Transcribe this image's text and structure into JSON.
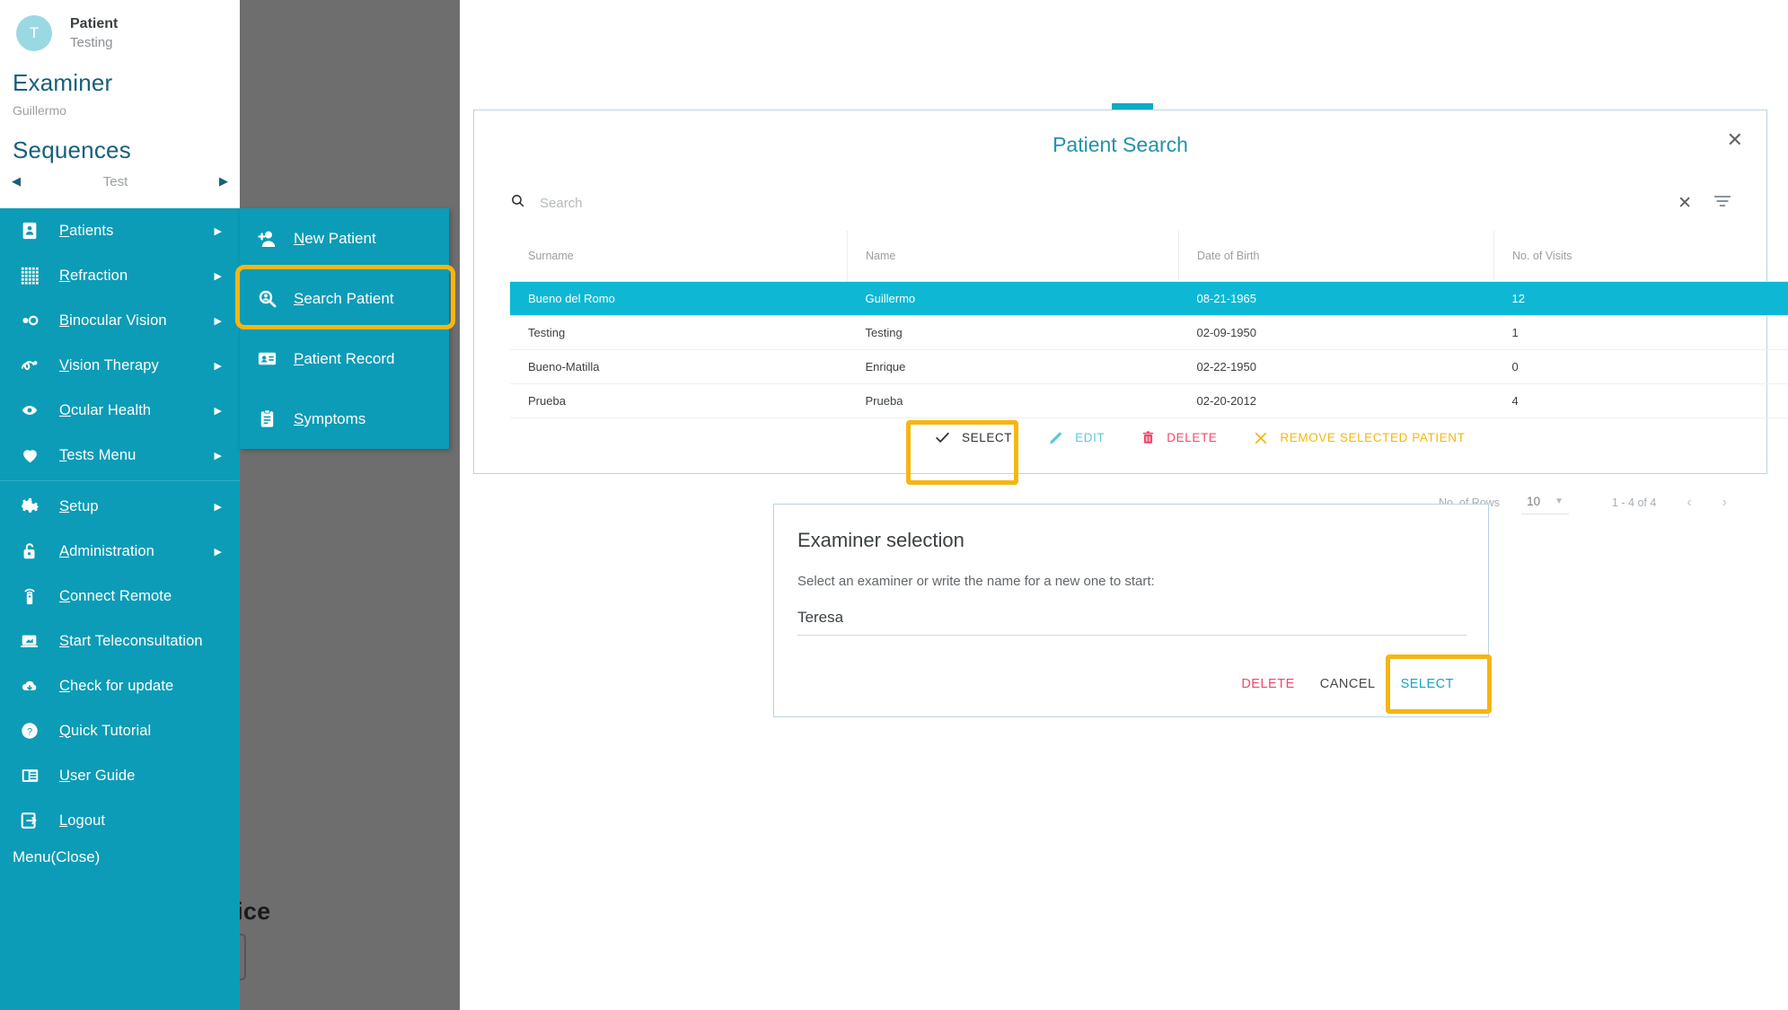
{
  "sidebar": {
    "patient": {
      "avatar_initial": "T",
      "label": "Patient",
      "name": "Testing"
    },
    "examiner": {
      "heading": "Examiner",
      "name": "Guillermo"
    },
    "sequences": {
      "heading": "Sequences",
      "current": "Test",
      "prev_icon": "chevron-left-icon",
      "next_icon": "chevron-right-icon"
    },
    "menu_items": [
      {
        "label": "Patients",
        "icon": "patient-card-icon",
        "caret": true,
        "accel": "P"
      },
      {
        "label": "Refraction",
        "icon": "grid-icon",
        "caret": true,
        "accel": "R"
      },
      {
        "label": "Binocular Vision",
        "icon": "binocular-icon",
        "caret": true,
        "accel": "B"
      },
      {
        "label": "Vision Therapy",
        "icon": "therapy-icon",
        "caret": true,
        "accel": "V"
      },
      {
        "label": "Ocular Health",
        "icon": "eye-icon",
        "caret": true,
        "accel": "O"
      },
      {
        "label": "Tests Menu",
        "icon": "heart-icon",
        "caret": true,
        "accel": "T"
      },
      {
        "label": "Setup",
        "icon": "gear-icon",
        "caret": true,
        "accel": "S"
      },
      {
        "label": "Administration",
        "icon": "lock-open-icon",
        "caret": true,
        "accel": "A"
      },
      {
        "label": "Connect Remote",
        "icon": "remote-icon",
        "caret": false,
        "accel": "C"
      },
      {
        "label": "Start Teleconsultation",
        "icon": "teleconsultation-icon",
        "caret": false,
        "accel": "S"
      },
      {
        "label": "Check for update",
        "icon": "cloud-download-icon",
        "caret": false,
        "accel": "C"
      },
      {
        "label": "Quick Tutorial",
        "icon": "question-circle-icon",
        "caret": false,
        "accel": "Q"
      },
      {
        "label": "User Guide",
        "icon": "book-icon",
        "caret": false,
        "accel": "U"
      },
      {
        "label": "Logout",
        "icon": "logout-icon",
        "caret": false,
        "accel": "L"
      }
    ],
    "menu_close": "Menu(Close)"
  },
  "submenu": {
    "items": [
      {
        "label": "New Patient",
        "icon": "person-add-icon",
        "accel": "N",
        "highlighted": false
      },
      {
        "label": "Search Patient",
        "icon": "search-person-icon",
        "accel": "S",
        "highlighted": true
      },
      {
        "label": "Patient Record",
        "icon": "id-card-icon",
        "accel": "P",
        "highlighted": false
      },
      {
        "label": "Symptoms",
        "icon": "clipboard-icon",
        "accel": "S",
        "highlighted": false
      }
    ]
  },
  "patient_search": {
    "title": "Patient Search",
    "close_icon": "close-icon",
    "search": {
      "placeholder": "Search",
      "value": "",
      "icon": "search-icon",
      "clear_icon": "clear-icon",
      "filter_icon": "filter-icon"
    },
    "columns": [
      "Surname",
      "Name",
      "Date of Birth",
      "No. of Visits"
    ],
    "rows": [
      {
        "surname": "Bueno del Romo",
        "name": "Guillermo",
        "dob": "08-21-1965",
        "visits": "12",
        "selected": true
      },
      {
        "surname": "Testing",
        "name": "Testing",
        "dob": "02-09-1950",
        "visits": "1",
        "selected": false
      },
      {
        "surname": "Bueno-Matilla",
        "name": "Enrique",
        "dob": "02-22-1950",
        "visits": "0",
        "selected": false
      },
      {
        "surname": "Prueba",
        "name": "Prueba",
        "dob": "02-20-2012",
        "visits": "4",
        "selected": false
      }
    ],
    "footer": {
      "rows_label": "No. of Rows",
      "rows_value": "10",
      "range": "1 - 4 of 4",
      "prev_icon": "chevron-left-icon",
      "next_icon": "chevron-right-icon"
    },
    "actions": [
      {
        "label": "SELECT",
        "icon": "check-icon",
        "highlighted": true
      },
      {
        "label": "EDIT",
        "icon": "pencil-icon",
        "highlighted": false
      },
      {
        "label": "DELETE",
        "icon": "trash-icon",
        "highlighted": false
      },
      {
        "label": "REMOVE SELECTED PATIENT",
        "icon": "x-icon",
        "highlighted": false
      }
    ]
  },
  "examiner_dialog": {
    "title": "Examiner selection",
    "subtitle": "Select an examiner or write the name for a new one to start:",
    "input_value": "Teresa",
    "input_placeholder": "",
    "delete_label": "DELETE",
    "cancel_label": "CANCEL",
    "select_label": "SELECT"
  },
  "background": {
    "ghost_text": "vice"
  },
  "colors": {
    "brand_teal": "#0c9cb7",
    "row_selected": "#0eb8d4",
    "highlight_yellow": "#f5b612",
    "title_teal": "#2391ab",
    "danger_pink": "#f24b6e",
    "backdrop_grey": "#6e6e6e"
  }
}
